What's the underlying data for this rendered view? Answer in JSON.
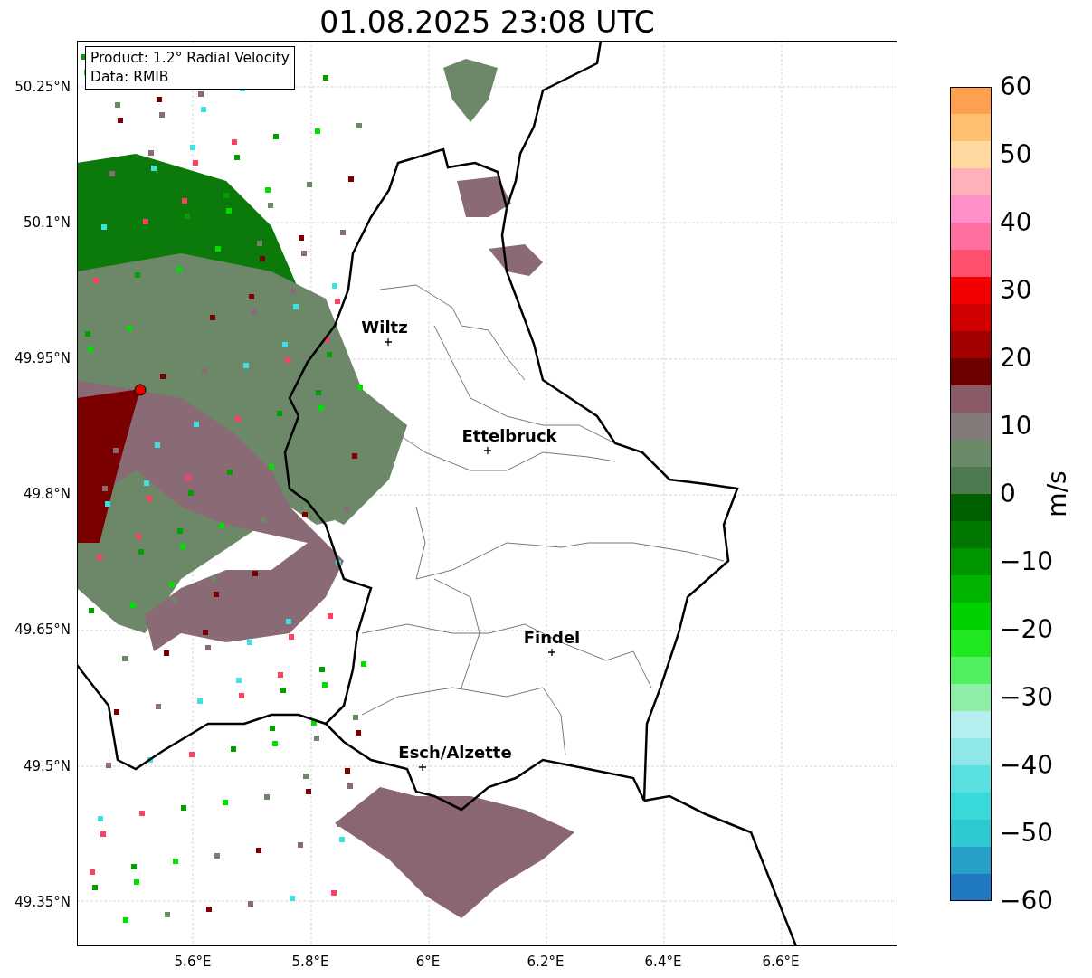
{
  "title": "01.08.2025 23:08 UTC",
  "info_box": [
    "Product: 1.2° Radial Velocity",
    "Data: RMIB"
  ],
  "y_ticks": [
    "50.25°N",
    "50.1°N",
    "49.95°N",
    "49.8°N",
    "49.65°N",
    "49.5°N",
    "49.35°N"
  ],
  "x_ticks": [
    "5.6°E",
    "5.8°E",
    "6°E",
    "6.2°E",
    "6.4°E",
    "6.6°E"
  ],
  "places": [
    "Wiltz",
    "Ettelbruck",
    "Findel",
    "Esch/Alzette"
  ],
  "colorbar": {
    "ticks": [
      "60",
      "50",
      "40",
      "30",
      "20",
      "10",
      "0",
      "−10",
      "−20",
      "−30",
      "−40",
      "−50",
      "−60"
    ],
    "label": "m/s"
  }
}
